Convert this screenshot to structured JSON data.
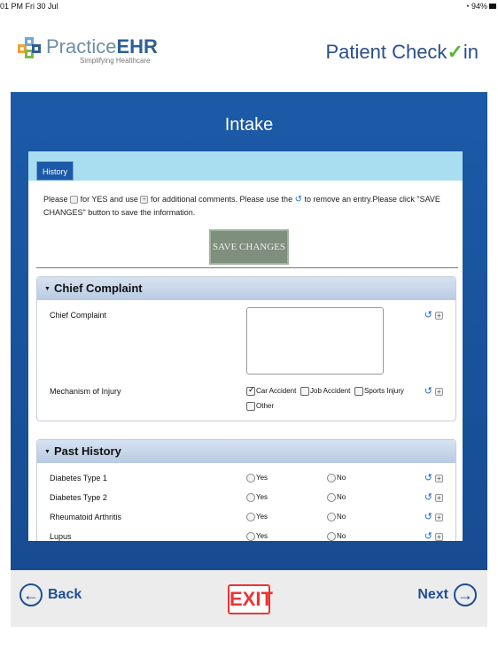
{
  "status": {
    "time": "01 PM  Fri 30 Jul",
    "battery": "94%"
  },
  "header": {
    "brand_first": "Practice",
    "brand_bold": "EHR",
    "tagline": "Simplifying Healthcare",
    "title_text": "Patient Check",
    "title_check": "✓",
    "title_end": "in"
  },
  "page": {
    "title": "Intake"
  },
  "tabs": [
    {
      "label": "History"
    }
  ],
  "instructions": {
    "part1": "Please",
    "part2": "for YES and use",
    "part3": "for additional comments. Please use the",
    "part4": "to remove an entry.Please click \"SAVE CHANGES\" button to save the information."
  },
  "save_button": {
    "label": "SAVE CHANGES"
  },
  "sections": [
    {
      "title": "Chief Complaint",
      "rows": [
        {
          "label": "Chief Complaint"
        },
        {
          "label": "Mechanism of Injury",
          "options": [
            "Car Accident",
            "Job Accident",
            "Sports Injury",
            "Other"
          ],
          "checked": "Car Accident"
        }
      ]
    },
    {
      "title": "Past History",
      "rows": [
        {
          "label": "Diabetes Type 1",
          "yes": "Yes",
          "no": "No"
        },
        {
          "label": "Diabetes Type 2",
          "yes": "Yes",
          "no": "No"
        },
        {
          "label": "Rheumatoid Arthritis",
          "yes": "Yes",
          "no": "No"
        },
        {
          "label": "Lupus",
          "yes": "Yes",
          "no": "No"
        }
      ]
    }
  ],
  "footer": {
    "back": "Back",
    "exit": "EXIT",
    "next": "Next"
  },
  "colors": {
    "panel_blue": "#1c5aa8",
    "tab_strip": "#a9def1",
    "exit_red": "#e33",
    "brand_green": "#5bb531"
  }
}
